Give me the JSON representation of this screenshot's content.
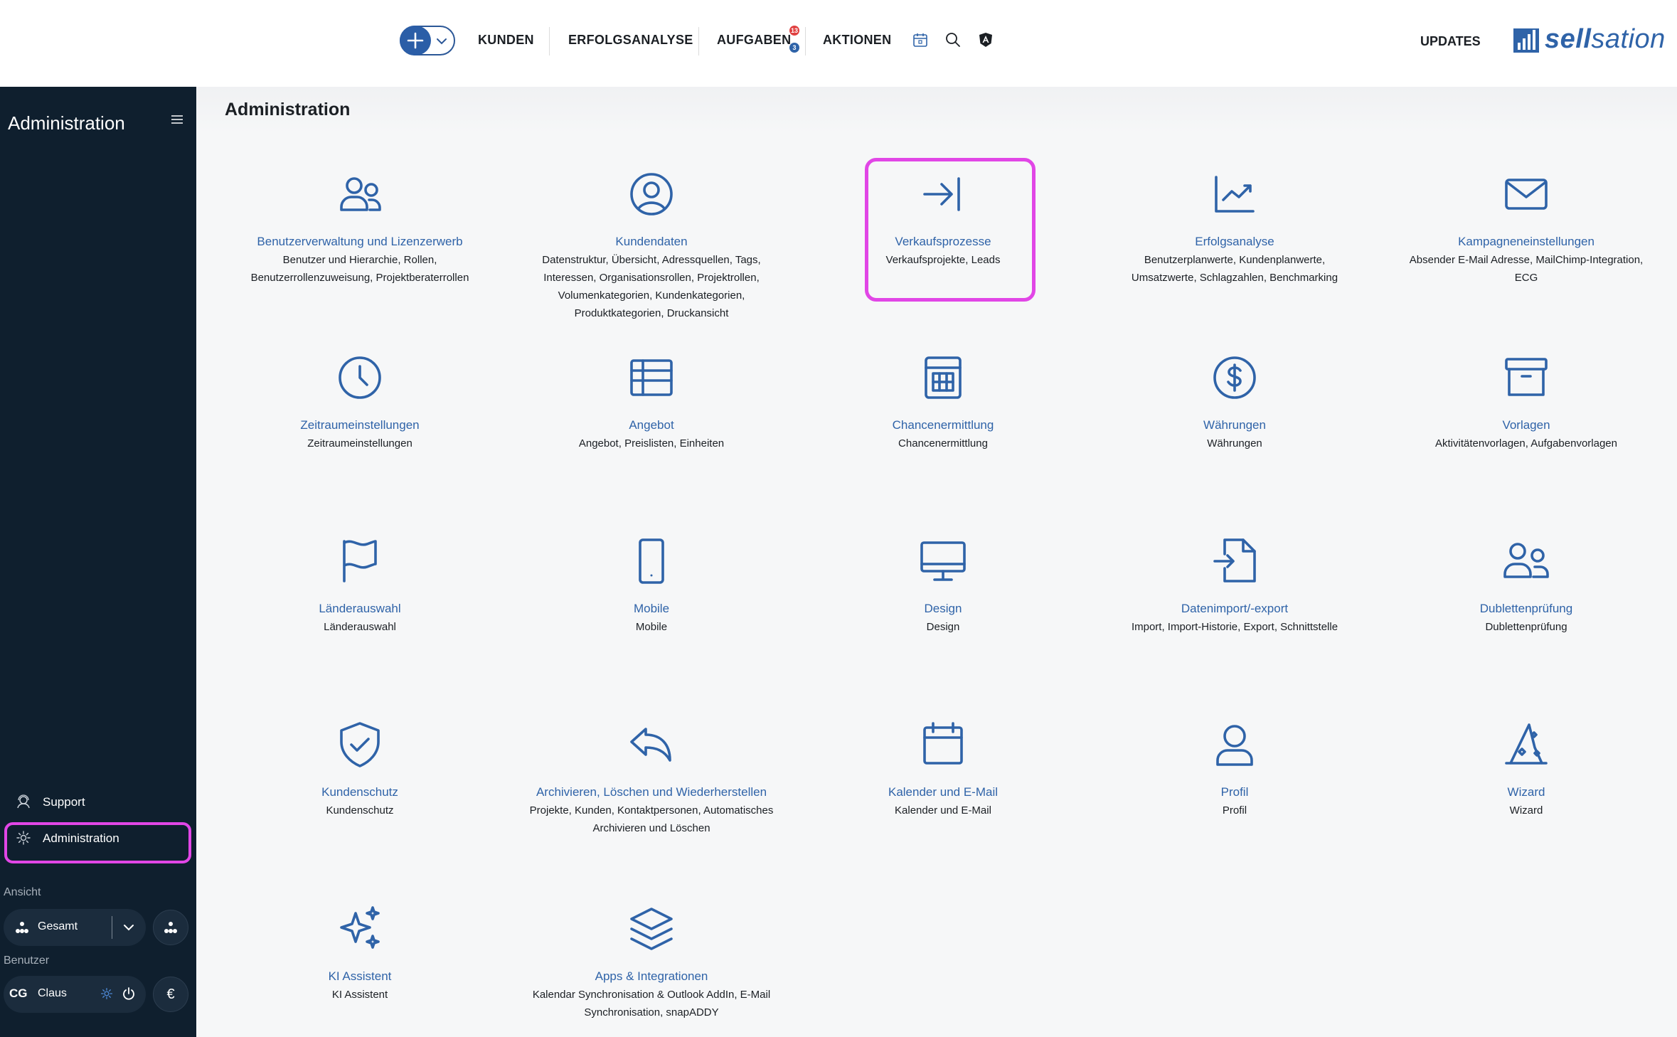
{
  "topbar": {
    "nav": [
      "KUNDEN",
      "ERFOLGSANALYSE",
      "AUFGABEN",
      "AKTIONEN"
    ],
    "aufgaben_badge_red": "13",
    "aufgaben_badge_blue": "3",
    "updates": "UPDATES",
    "logo_part1": "sell",
    "logo_part2": "sation"
  },
  "sidebar": {
    "title": "Administration",
    "support": "Support",
    "administration": "Administration",
    "ansicht_label": "Ansicht",
    "ansicht_value": "Gesamt",
    "benutzer_label": "Benutzer",
    "user_initials": "CG",
    "user_name": "Claus",
    "currency": "€"
  },
  "page": {
    "title": "Administration"
  },
  "tiles": [
    {
      "icon": "users-icon",
      "title": "Benutzerverwaltung und Lizenzerwerb",
      "desc": "Benutzer und Hierarchie, Rollen, Benutzerrollenzuweisung, Projektberaterrollen"
    },
    {
      "icon": "user-circle-icon",
      "title": "Kundendaten",
      "desc": "Datenstruktur, Übersicht, Adressquellen, Tags, Interessen, Organisationsrollen, Projektrollen, Volumenkategorien, Kundenkategorien, Produktkategorien, Druckansicht"
    },
    {
      "icon": "arrow-to-line-icon",
      "title": "Verkaufsprozesse",
      "desc": "Verkaufsprojekte, Leads"
    },
    {
      "icon": "chart-line-icon",
      "title": "Erfolgsanalyse",
      "desc": "Benutzerplanwerte, Kundenplanwerte, Umsatzwerte, Schlagzahlen, Benchmarking"
    },
    {
      "icon": "envelope-icon",
      "title": "Kampagneneinstellungen",
      "desc": "Absender E-Mail Adresse, MailChimp-Integration, ECG"
    },
    {
      "icon": "clock-icon",
      "title": "Zeitraumeinstellungen",
      "desc": "Zeitraumeinstellungen"
    },
    {
      "icon": "table-icon",
      "title": "Angebot",
      "desc": "Angebot, Preislisten, Einheiten"
    },
    {
      "icon": "calculator-grid-icon",
      "title": "Chancenermittlung",
      "desc": "Chancenermittlung"
    },
    {
      "icon": "dollar-circle-icon",
      "title": "Währungen",
      "desc": "Währungen"
    },
    {
      "icon": "archive-box-icon",
      "title": "Vorlagen",
      "desc": "Aktivitätenvorlagen, Aufgabenvorlagen"
    },
    {
      "icon": "flag-icon",
      "title": "Länderauswahl",
      "desc": "Länderauswahl"
    },
    {
      "icon": "mobile-icon",
      "title": "Mobile",
      "desc": "Mobile"
    },
    {
      "icon": "desktop-icon",
      "title": "Design",
      "desc": "Design"
    },
    {
      "icon": "file-import-icon",
      "title": "Datenimport/-export",
      "desc": "Import, Import-Historie, Export, Schnittstelle"
    },
    {
      "icon": "users-duplicate-icon",
      "title": "Dublettenprüfung",
      "desc": "Dublettenprüfung"
    },
    {
      "icon": "shield-check-icon",
      "title": "Kundenschutz",
      "desc": "Kundenschutz"
    },
    {
      "icon": "reply-arrow-icon",
      "title": "Archivieren, Löschen und Wiederherstellen",
      "desc": "Projekte, Kunden, Kontaktpersonen, Automatisches Archivieren und Löschen"
    },
    {
      "icon": "calendar-icon",
      "title": "Kalender und E-Mail",
      "desc": "Kalender und E-Mail"
    },
    {
      "icon": "user-icon",
      "title": "Profil",
      "desc": "Profil"
    },
    {
      "icon": "wizard-hat-icon",
      "title": "Wizard",
      "desc": "Wizard"
    },
    {
      "icon": "sparkles-icon",
      "title": "KI Assistent",
      "desc": "KI Assistent"
    },
    {
      "icon": "layers-icon",
      "title": "Apps & Integrationen",
      "desc": "Kalendar Synchronisation & Outlook AddIn, E-Mail Synchronisation, snapADDY"
    }
  ],
  "colors": {
    "accent": "#2f63a8",
    "sidebar": "#0f1f2e",
    "highlight": "#e146e6"
  }
}
